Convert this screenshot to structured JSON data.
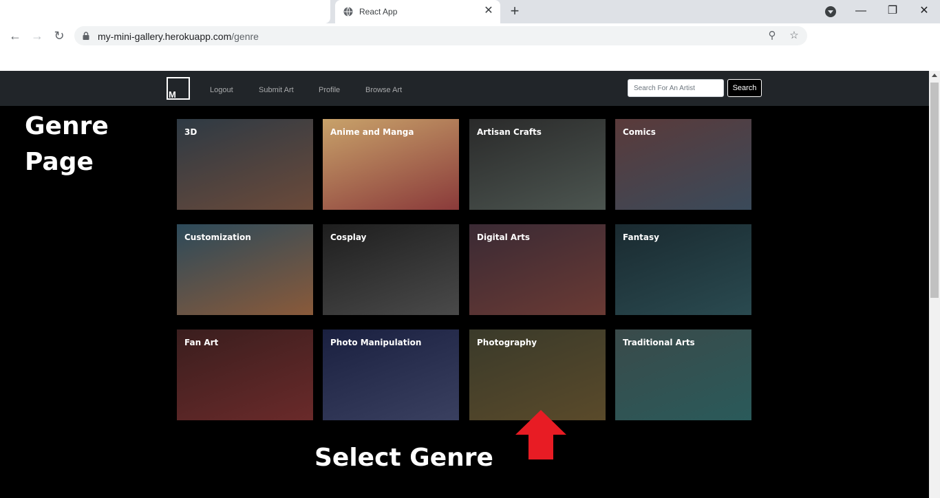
{
  "browser": {
    "tab_title": "React App",
    "url_host": "my-mini-gallery.herokuapp.com",
    "url_path": "/genre"
  },
  "navbar": {
    "logo_text": "M",
    "links": [
      "Logout",
      "Submit Art",
      "Profile",
      "Browse Art"
    ],
    "search_placeholder": "Search For An Artist",
    "search_button": "Search"
  },
  "annotations": {
    "genre_page_line1": "Genre",
    "genre_page_line2": "Page",
    "select_genre": "Select Genre"
  },
  "genres": [
    {
      "name": "3D",
      "colors": [
        "#2e3a44",
        "#6b4a3a"
      ]
    },
    {
      "name": "Anime and Manga",
      "colors": [
        "#c8a26a",
        "#8a3a3a"
      ]
    },
    {
      "name": "Artisan Crafts",
      "colors": [
        "#2a2a2a",
        "#4c5550"
      ]
    },
    {
      "name": "Comics",
      "colors": [
        "#5a3a3a",
        "#3a4a5a"
      ]
    },
    {
      "name": "Customization",
      "colors": [
        "#2c4a5a",
        "#8a5a3a"
      ]
    },
    {
      "name": "Cosplay",
      "colors": [
        "#1e1e1e",
        "#4a4a4a"
      ]
    },
    {
      "name": "Digital Arts",
      "colors": [
        "#3a2a34",
        "#6a3a34"
      ]
    },
    {
      "name": "Fantasy",
      "colors": [
        "#1a2a30",
        "#2a4a50"
      ]
    },
    {
      "name": "Fan Art",
      "colors": [
        "#3a1e1e",
        "#6a2a2a"
      ]
    },
    {
      "name": "Photo Manipulation",
      "colors": [
        "#1a2040",
        "#3a4060"
      ]
    },
    {
      "name": "Photography",
      "colors": [
        "#3a3a2a",
        "#5a4a2a"
      ]
    },
    {
      "name": "Traditional Arts",
      "colors": [
        "#3a4a4a",
        "#2a5a5a"
      ]
    }
  ],
  "colors": {
    "navbar_bg": "#212529",
    "page_bg": "#000000",
    "arrow": "#e81c24"
  }
}
